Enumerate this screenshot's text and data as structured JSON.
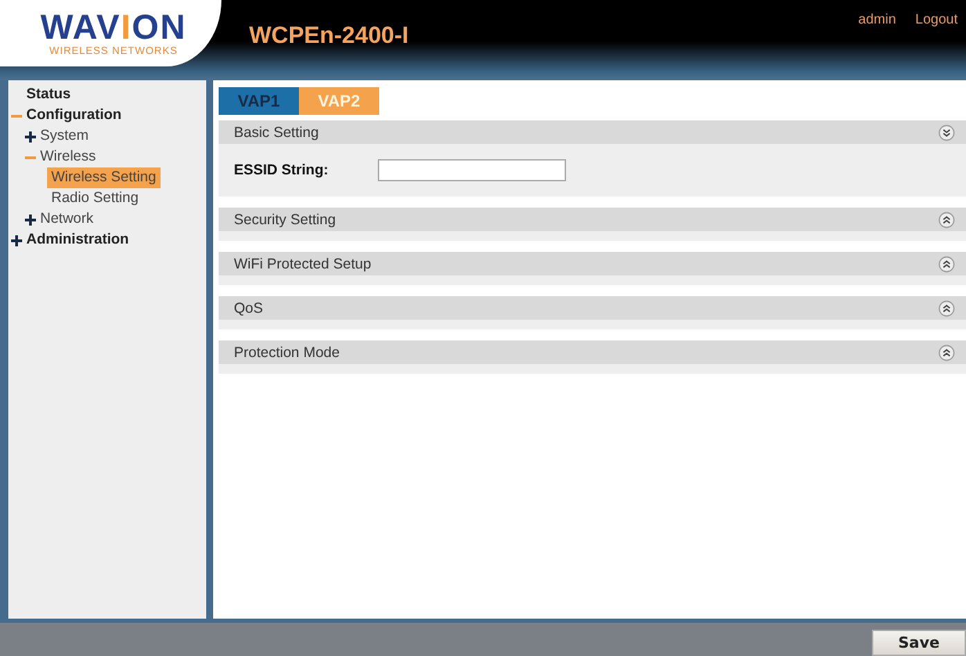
{
  "logo": {
    "parts": [
      {
        "text": "WAV",
        "accent": false
      },
      {
        "text": "I",
        "accent": true
      },
      {
        "text": "ON",
        "accent": false
      }
    ],
    "tagline": "WIRELESS NETWORKS"
  },
  "product": "WCPEn-2400-I",
  "user_links": [
    "admin",
    "Logout"
  ],
  "sidebar": {
    "items": [
      {
        "label": "Status",
        "kind": "link",
        "selected": false
      },
      {
        "label": "Configuration",
        "kind": "top",
        "expanded": true,
        "selected": false,
        "children": [
          {
            "label": "System",
            "kind": "sub",
            "expanded": false,
            "selected": false
          },
          {
            "label": "Wireless",
            "kind": "sub",
            "expanded": true,
            "selected": false,
            "children": [
              {
                "label": "Wireless Setting",
                "kind": "leaf",
                "selected": true
              },
              {
                "label": "Radio Setting",
                "kind": "leaf",
                "selected": false
              }
            ]
          },
          {
            "label": "Network",
            "kind": "sub",
            "expanded": false,
            "selected": false
          }
        ]
      },
      {
        "label": "Administration",
        "kind": "top",
        "expanded": false,
        "selected": false
      }
    ]
  },
  "tabs": [
    {
      "label": "VAP1",
      "selected": false
    },
    {
      "label": "VAP2",
      "selected": true
    }
  ],
  "sections": [
    {
      "title": "Basic Setting",
      "expanded": true,
      "fields": [
        {
          "label": "ESSID String:"
        }
      ]
    },
    {
      "title": "Security Setting",
      "expanded": false
    },
    {
      "title": "WiFi Protected Setup",
      "expanded": false
    },
    {
      "title": "QoS",
      "expanded": false
    },
    {
      "title": "Protection Mode",
      "expanded": false
    }
  ],
  "footer": {
    "button": "Save"
  }
}
